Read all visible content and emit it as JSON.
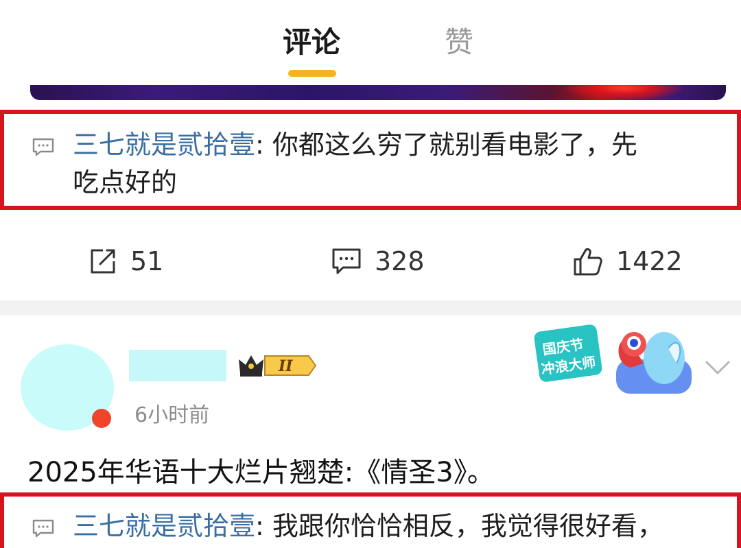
{
  "tabs": {
    "comments_label": "评论",
    "likes_label": "赞"
  },
  "first_reply": {
    "author": "三七就是贰拾壹",
    "separator": ": ",
    "line1": "你都这么穷了就别看电影了，先",
    "line2": "吃点好的"
  },
  "actions": {
    "repost_count": "51",
    "comment_count": "328",
    "like_count": "1422"
  },
  "post": {
    "time": "6小时前",
    "vip_level": "II",
    "text": "2025年华语十大烂片翘楚:《情圣3》。",
    "sticker_line1": "国庆节",
    "sticker_line2": "冲浪大师"
  },
  "second_reply": {
    "author": "三七就是贰拾壹",
    "separator": ": ",
    "text": "我跟你恰恰相反，我觉得很好看，"
  },
  "colors": {
    "highlight_border": "#d6141d",
    "author_link": "#3a6ea3",
    "tab_indicator": "#f5b223",
    "redacted_cyan": "#c6f7f9"
  },
  "icons": [
    "comment-bubble-icon",
    "repost-icon",
    "comment-icon",
    "thumbs-up-icon",
    "crown-icon",
    "chevron-down-icon"
  ]
}
